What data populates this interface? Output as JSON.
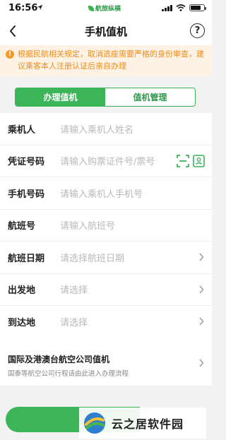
{
  "status_bar": {
    "time": "16:56",
    "app_name": "航旅纵横"
  },
  "nav": {
    "title": "手机值机",
    "help_label": "?"
  },
  "notice": {
    "icon_label": "!",
    "text": "根据民航相关规定，取消选座需要严格的身份审查，建议乘客本人注册认证后亲自办理"
  },
  "tabs": [
    {
      "label": "办理值机",
      "active": true
    },
    {
      "label": "值机管理",
      "active": false
    }
  ],
  "form": {
    "rows": [
      {
        "label": "乘机人",
        "placeholder": "请输入乘机人姓名"
      },
      {
        "label": "凭证号码",
        "placeholder": "请输入购票证件号/票号"
      },
      {
        "label": "手机号码",
        "placeholder": "请输入乘机人手机号"
      },
      {
        "label": "航班号",
        "placeholder": "请输入航班号"
      },
      {
        "label": "航班日期",
        "placeholder": "请选择航班日期"
      },
      {
        "label": "出发地",
        "placeholder": "请选择"
      },
      {
        "label": "到达地",
        "placeholder": "请选择"
      }
    ]
  },
  "international": {
    "title": "国际及港澳台航空公司值机",
    "subtitle": "国泰等航空公司行程请由此进入办理流程"
  },
  "watermark": {
    "text": "云之居软件园"
  },
  "colors": {
    "accent": "#3cb458",
    "notice_bg": "#fdf2e3",
    "notice_text": "#f08c1a",
    "placeholder": "#b9b9b9"
  },
  "icons": [
    "location-arrow-icon",
    "signal-icon",
    "wifi-icon",
    "battery-icon",
    "back-chevron-icon",
    "help-icon",
    "warning-icon",
    "scan-icon",
    "id-card-icon",
    "chevron-right-icon"
  ]
}
